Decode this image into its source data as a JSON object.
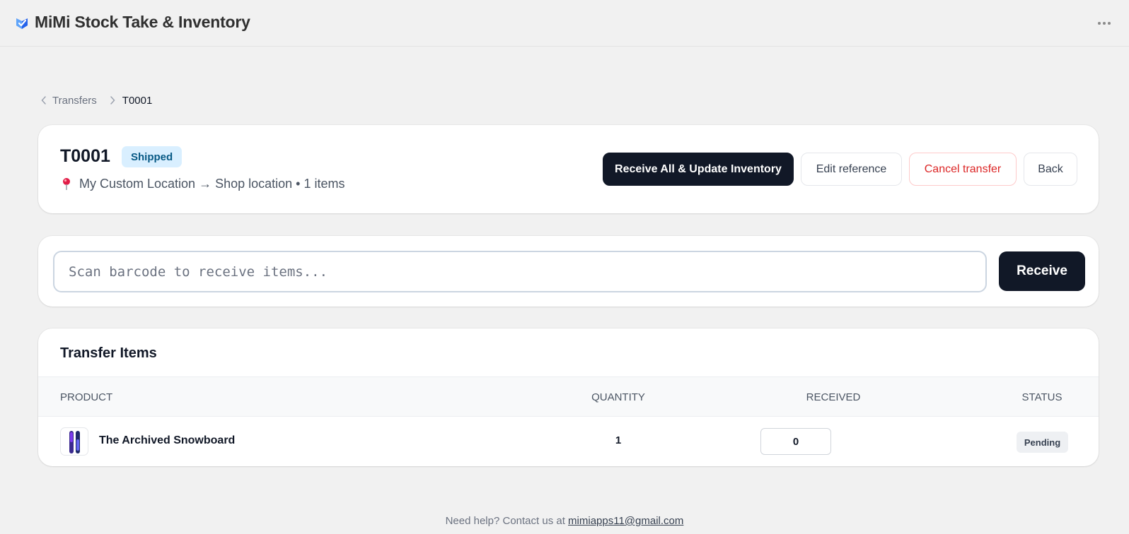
{
  "app": {
    "title": "MiMi Stock Take & Inventory",
    "logo_icon": "mimi-logo-icon",
    "more_icon": "more-horizontal-icon"
  },
  "breadcrumb": {
    "parent": "Transfers",
    "current": "T0001"
  },
  "transfer": {
    "id": "T0001",
    "status": "Shipped",
    "route": "My Custom Location → Shop location • 1 items",
    "pin_icon": "location-pin-icon"
  },
  "actions": {
    "receive_all": "Receive All & Update Inventory",
    "edit_reference": "Edit reference",
    "cancel_transfer": "Cancel transfer",
    "back": "Back"
  },
  "scan": {
    "placeholder": "Scan barcode to receive items...",
    "value": "",
    "button": "Receive"
  },
  "items": {
    "title": "Transfer Items",
    "columns": {
      "product": "PRODUCT",
      "quantity": "QUANTITY",
      "received": "RECEIVED",
      "status": "STATUS"
    },
    "rows": [
      {
        "product": "The Archived Snowboard",
        "quantity": "1",
        "received": "0",
        "status": "Pending"
      }
    ]
  },
  "footer": {
    "text": "Need help? Contact us at ",
    "email": "mimiapps11@gmail.com"
  },
  "colors": {
    "primary": "#111827",
    "shipped_badge_bg": "#d9efff",
    "shipped_badge_text": "#075985",
    "danger": "#dc2626",
    "page_bg": "#f1f1f1"
  }
}
